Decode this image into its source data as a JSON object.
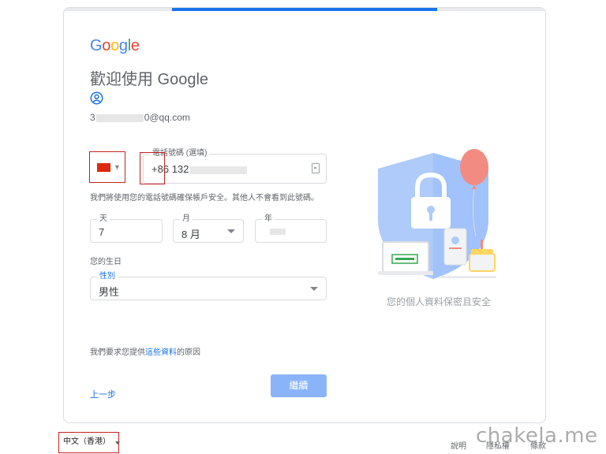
{
  "header": {
    "logo_letters": [
      {
        "char": "G",
        "color": "#4285F4"
      },
      {
        "char": "o",
        "color": "#EA4335"
      },
      {
        "char": "o",
        "color": "#FBBC05"
      },
      {
        "char": "g",
        "color": "#4285F4"
      },
      {
        "char": "l",
        "color": "#34A853"
      },
      {
        "char": "e",
        "color": "#EA4335"
      }
    ],
    "title": "歡迎使用 Google",
    "progress_fraction": 0.55
  },
  "account": {
    "icon": "account-circle-icon",
    "email_prefix": "3",
    "email_suffix": "0@qq.com"
  },
  "phone": {
    "country_flag": "china-flag-icon",
    "label": "電話號碼 (選填)",
    "country_code": "+86",
    "number_prefix": "132",
    "note": "我們將使用您的電話號碼確保帳戶安全。其他人不會看到此號碼。"
  },
  "birthday": {
    "day_label": "天",
    "day_value": "7",
    "month_label": "月",
    "month_value": "8 月",
    "year_label": "年",
    "section_label": "您的生日"
  },
  "gender": {
    "label": "性別",
    "value": "男性"
  },
  "reason": {
    "prefix": "我們要求您提供",
    "link": "這些資料",
    "suffix": "的原因"
  },
  "actions": {
    "back_label": "上一步",
    "next_label": "繼續"
  },
  "illustration": {
    "caption": "您的個人資料保密且安全"
  },
  "footer": {
    "language": "中文（香港）",
    "help": "說明",
    "privacy": "隱私權",
    "terms": "條款"
  },
  "watermark": "chakela.me",
  "colors": {
    "accent": "#1a73e8",
    "button_disabled": "#8ab4f8",
    "highlight_box": "#c5221f"
  }
}
